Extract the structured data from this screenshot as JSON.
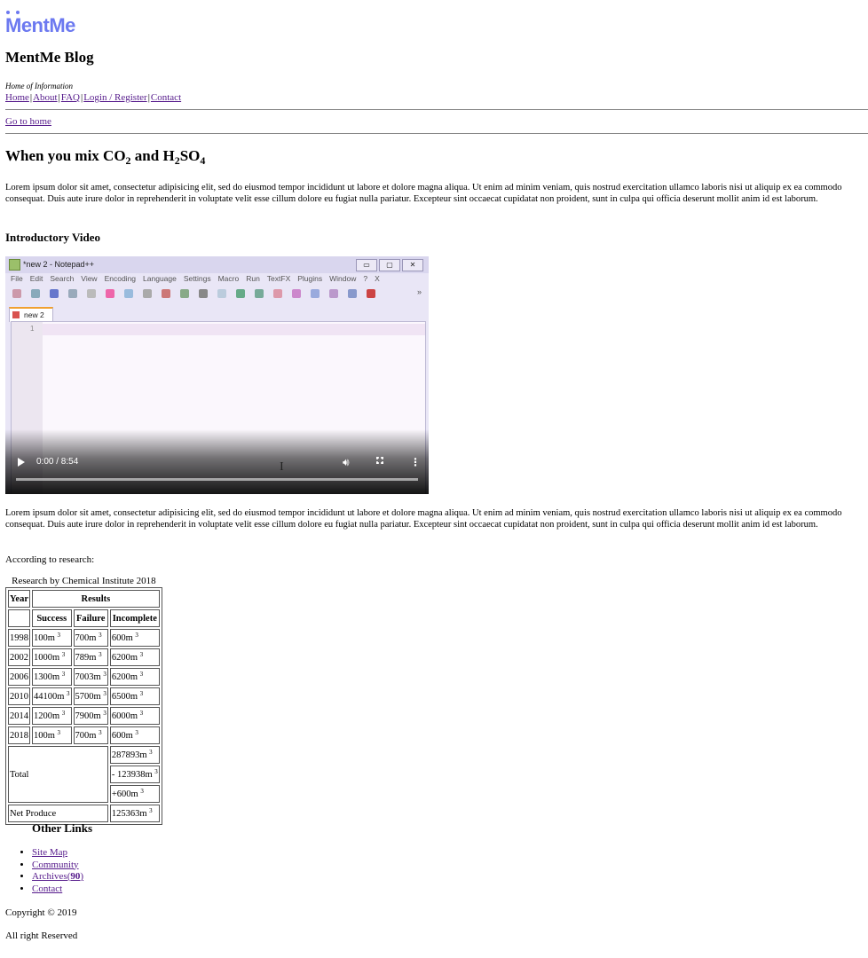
{
  "logo": {
    "text": "MentMe"
  },
  "blog_title": "MentMe Blog",
  "tagline": "Home of Information",
  "nav": [
    {
      "label": "Home"
    },
    {
      "label": "About"
    },
    {
      "label": "FAQ"
    },
    {
      "label": "Login / Register"
    },
    {
      "label": "Contact"
    }
  ],
  "nav_separator": "|",
  "go_to_home": "Go to home",
  "post": {
    "title_prefix": "When you mix CO",
    "title_sub1": "2",
    "title_mid": " and H",
    "title_sub2": "2",
    "title_mid2": "SO",
    "title_sub3": "4",
    "paragraph1": "Lorem ipsum dolor sit amet, consectetur adipisicing elit, sed do eiusmod tempor incididunt ut labore et dolore magna aliqua. Ut enim ad minim veniam, quis nostrud exercitation ullamco laboris nisi ut aliquip ex ea commodo consequat. Duis aute irure dolor in reprehenderit in voluptate velit esse cillum dolore eu fugiat nulla pariatur. Excepteur sint occaecat cupidatat non proident, sunt in culpa qui officia deserunt mollit anim id est laborum.",
    "video_heading": "Introductory Video",
    "paragraph2": "Lorem ipsum dolor sit amet, consectetur adipisicing elit, sed do eiusmod tempor incididunt ut labore et dolore magna aliqua. Ut enim ad minim veniam, quis nostrud exercitation ullamco laboris nisi ut aliquip ex ea commodo consequat. Duis aute irure dolor in reprehenderit in voluptate velit esse cillum dolore eu fugiat nulla pariatur. Excepteur sint occaecat cupidatat non proident, sunt in culpa qui officia deserunt mollit anim id est laborum.",
    "according": "According to research:"
  },
  "video": {
    "time": "0:00 / 8:54",
    "progress": 0,
    "frame": {
      "window_title": "*new 2 - Notepad++",
      "menu": [
        "File",
        "Edit",
        "Search",
        "View",
        "Encoding",
        "Language",
        "Settings",
        "Macro",
        "Run",
        "TextFX",
        "Plugins",
        "Window",
        "?",
        "X"
      ],
      "tab_label": "new 2",
      "line_number": "1",
      "overflow": "»"
    }
  },
  "table": {
    "caption": "Research by Chemical Institute 2018",
    "header_year": "Year",
    "header_results": "Results",
    "subheaders": [
      "Success",
      "Failure",
      "Incomplete"
    ],
    "unit_sup": "3",
    "rows": [
      {
        "year": "1998",
        "success": "100m",
        "failure": "700m",
        "incomplete": "600m"
      },
      {
        "year": "2002",
        "success": "1000m",
        "failure": "789m",
        "incomplete": "6200m"
      },
      {
        "year": "2006",
        "success": "1300m",
        "failure": "7003m",
        "incomplete": "6200m"
      },
      {
        "year": "2010",
        "success": "44100m",
        "failure": "5700m",
        "incomplete": "6500m"
      },
      {
        "year": "2014",
        "success": "1200m",
        "failure": "7900m",
        "incomplete": "6000m"
      },
      {
        "year": "2018",
        "success": "100m",
        "failure": "700m",
        "incomplete": "600m"
      }
    ],
    "total_label": "Total",
    "totals": [
      "287893m",
      "- 123938m",
      "+600m"
    ],
    "net_label": "Net Produce",
    "net_value": "125363m"
  },
  "other_links": {
    "heading": "Other Links",
    "items": [
      {
        "label": "Site Map"
      },
      {
        "label": "Community"
      },
      {
        "label": "Archives(",
        "bold": "90",
        "end": ")"
      },
      {
        "label": "Contact"
      }
    ]
  },
  "footer": {
    "copyright": "Copyright © 2019",
    "rights": "All right Reserved"
  }
}
